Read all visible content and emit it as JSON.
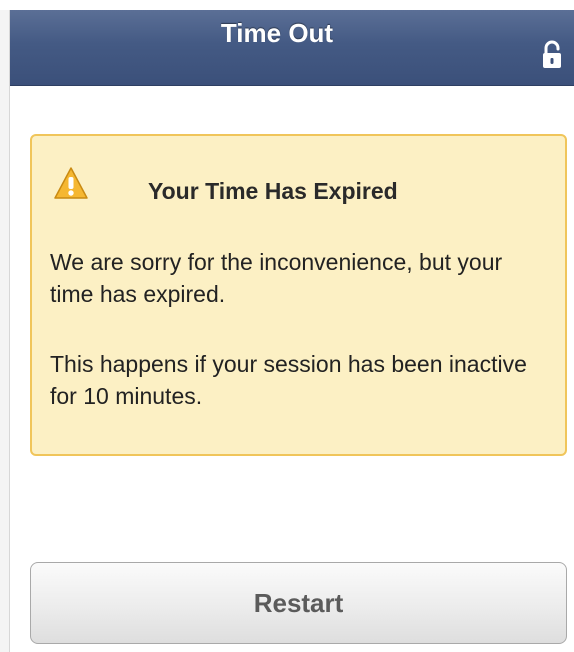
{
  "header": {
    "title": "Time Out",
    "lock_icon": "unlocked-lock-icon"
  },
  "notice": {
    "icon": "warning-icon",
    "title": "Your Time Has Expired",
    "paragraph_1": "We are sorry for the inconvenience, but your time has expired.",
    "paragraph_2": "This happens if your session has been inactive for 10 minutes."
  },
  "actions": {
    "restart_label": "Restart"
  },
  "colors": {
    "header_bg": "#445a84",
    "notice_bg": "#fcf0c4",
    "notice_border": "#f0c55a",
    "warning_fill": "#f5b731"
  }
}
